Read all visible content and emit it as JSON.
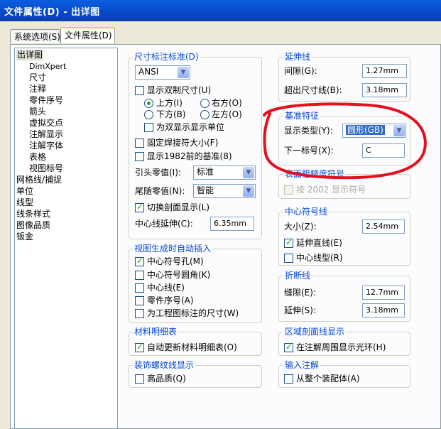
{
  "window": {
    "title": "文件属性(D) - 出详图"
  },
  "tabs": [
    "系统选项(S)",
    "文件属性(D)"
  ],
  "tree": {
    "items": [
      "出详图",
      "DimXpert",
      "尺寸",
      "注释",
      "零件序号",
      "箭头",
      "虚拟交点",
      "注解显示",
      "注解字体",
      "表格",
      "视图标号",
      "网格线/捕捉",
      "单位",
      "线型",
      "线条样式",
      "图像品质",
      "钣金"
    ]
  },
  "dim_standard": {
    "title": "尺寸标注标准(D)",
    "standard": "ANSI",
    "dual_display": "显示双制尺寸(U)",
    "radios": {
      "up": "上方(I)",
      "right": "右方(O)",
      "down": "下方(B)",
      "left": "左方(O)"
    },
    "dual_unit": "为双显示显示单位",
    "fixed_size": "固定焊接符大小(F)",
    "show_1982": "显示1982前的基准(8)",
    "leading_label": "引头零值(I):",
    "leading_value": "标准",
    "trailing_label": "尾随零值(N):",
    "trailing_value": "智能",
    "toggle_section": "切换剖面显示(L)",
    "centerline_label": "中心线延伸(C):",
    "centerline_value": "6.35mm"
  },
  "auto_insert": {
    "title": "视图生成时自动插入",
    "items": [
      "中心符号孔(M)",
      "中心符号圆角(K)",
      "中心线(E)",
      "零件序号(A)",
      "为工程图标注的尺寸(W)"
    ],
    "checked": [
      true,
      false,
      false,
      false,
      false
    ]
  },
  "bom": {
    "title": "材料明细表",
    "item": "自动更新材料明细表(O)"
  },
  "thread": {
    "title": "装饰螺纹线显示",
    "item": "高品质(Q)"
  },
  "extension": {
    "title": "延伸线",
    "gap_label": "间隙(G):",
    "gap_value": "1.27mm",
    "beyond_label": "超出尺寸线(B):",
    "beyond_value": "3.18mm"
  },
  "datum": {
    "title": "基准特征",
    "type_label": "显示类型(Y):",
    "type_value": "圆形(GB)",
    "next_label": "下一标号(X):",
    "next_value": "C"
  },
  "surface": {
    "title": "表面粗糙度符号",
    "item": "按 2002 显示符号"
  },
  "center_mark": {
    "title": "中心符号线",
    "size_label": "大小(Z):",
    "size_value": "2.54mm",
    "ext_line": "延伸直线(E)",
    "center_linetype": "中心线型(R)"
  },
  "break_line": {
    "title": "折断线",
    "gap_label": "缝隙(E):",
    "gap_value": "12.7mm",
    "ext_label": "延伸(S):",
    "ext_value": "3.18mm"
  },
  "hatch": {
    "title": "区域剖面线显示",
    "item": "在注解周围显示光环(H)"
  },
  "input_note": {
    "title": "输入注解",
    "item": "从整个装配体(A)"
  },
  "colors": {
    "accent": "#0046D5",
    "title_bar": "#0A5FE0",
    "check": "#21A121",
    "annotation": "#E4101E",
    "selection": "#316AC5"
  }
}
